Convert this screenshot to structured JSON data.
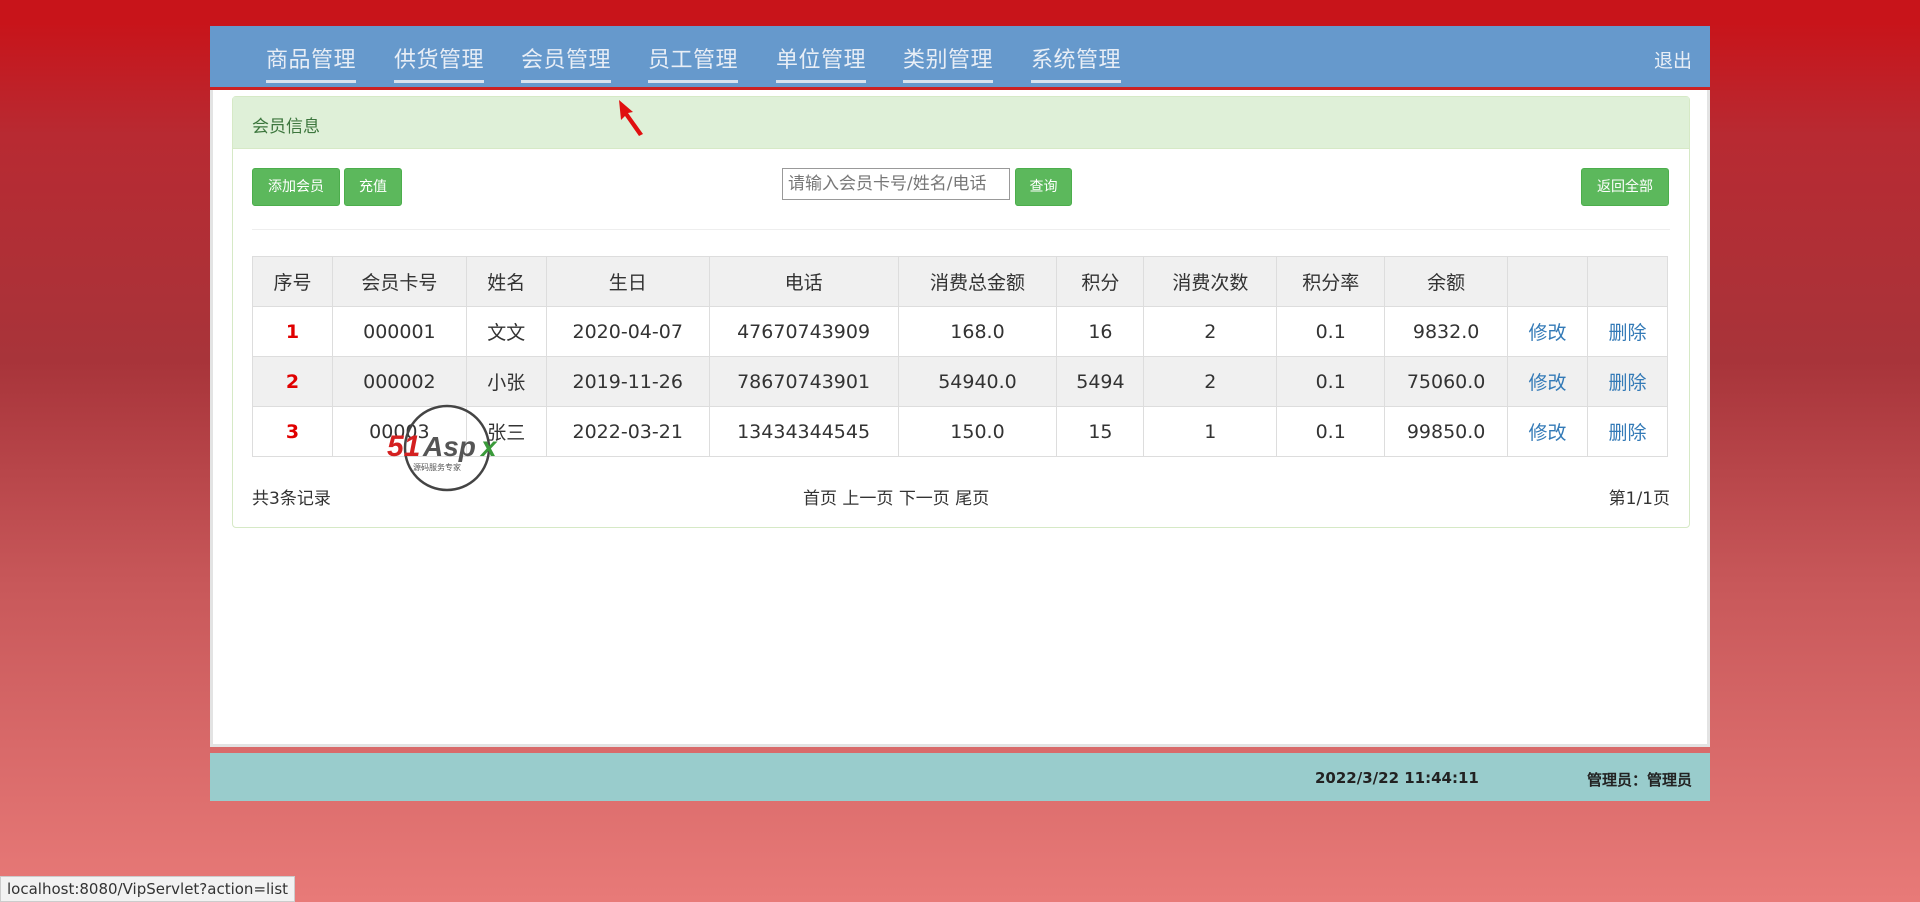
{
  "nav": {
    "items": [
      "商品管理",
      "供货管理",
      "会员管理",
      "员工管理",
      "单位管理",
      "类别管理",
      "系统管理"
    ],
    "logout": "退出"
  },
  "panel": {
    "title": "会员信息"
  },
  "toolbar": {
    "add_member": "添加会员",
    "recharge": "充值",
    "search_placeholder": "请输入会员卡号/姓名/电话",
    "search_value": "",
    "query": "查询",
    "back_all": "返回全部"
  },
  "table": {
    "headers": [
      "序号",
      "会员卡号",
      "姓名",
      "生日",
      "电话",
      "消费总金额",
      "积分",
      "消费次数",
      "积分率",
      "余额",
      "",
      ""
    ],
    "rows": [
      {
        "idx": "1",
        "card": "000001",
        "name": "文文",
        "birthday": "2020-04-07",
        "phone": "47670743909",
        "total": "168.0",
        "points": "16",
        "times": "2",
        "rate": "0.1",
        "balance": "9832.0",
        "edit": "修改",
        "delete": "删除"
      },
      {
        "idx": "2",
        "card": "000002",
        "name": "小张",
        "birthday": "2019-11-26",
        "phone": "78670743901",
        "total": "54940.0",
        "points": "5494",
        "times": "2",
        "rate": "0.1",
        "balance": "75060.0",
        "edit": "修改",
        "delete": "删除"
      },
      {
        "idx": "3",
        "card": "00003",
        "name": "张三",
        "birthday": "2022-03-21",
        "phone": "13434344545",
        "total": "150.0",
        "points": "15",
        "times": "1",
        "rate": "0.1",
        "balance": "99850.0",
        "edit": "修改",
        "delete": "删除"
      }
    ]
  },
  "pagination": {
    "total_records": "共3条记录",
    "first": "首页",
    "prev": "上一页",
    "next": "下一页",
    "last": "尾页",
    "page_info": "第1/1页"
  },
  "footer": {
    "datetime": "2022/3/22 11:44:11",
    "admin": "管理员：管理员"
  },
  "statusbar": {
    "url": "localhost:8080/VipServlet?action=list"
  },
  "watermark": {
    "brand": "51Aspx",
    "tagline": "源码服务专家"
  },
  "colors": {
    "nav_bg": "#6699cc",
    "button_green": "#5cb85c",
    "panel_heading_bg": "#dff0d8",
    "link_blue": "#337ab7",
    "index_red": "#e00000",
    "footer_bg": "#99cccc"
  }
}
